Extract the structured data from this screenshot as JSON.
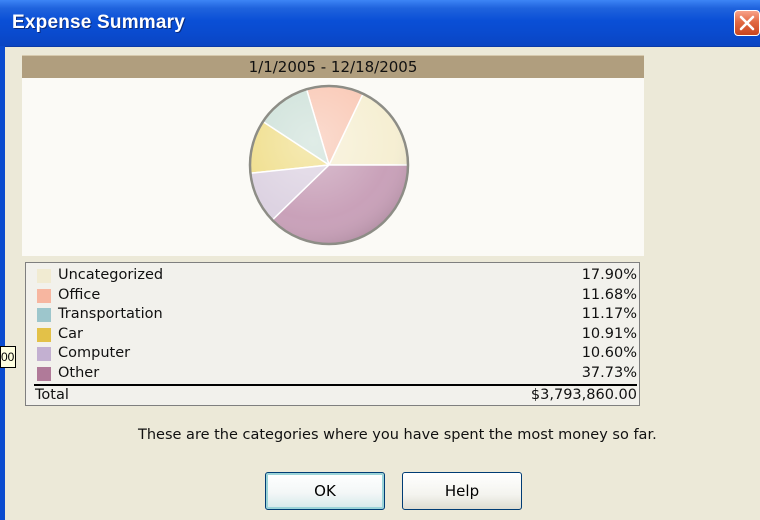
{
  "window": {
    "title": "Expense Summary",
    "close_icon": "close-icon"
  },
  "summary": {
    "date_range": "1/1/2005 - 12/18/2005"
  },
  "chart_data": {
    "type": "pie",
    "slices": [
      {
        "label": "Uncategorized",
        "value": 17.9,
        "color": "#f6efd3"
      },
      {
        "label": "Office",
        "value": 11.68,
        "color": "#f9c9b6"
      },
      {
        "label": "Transportation",
        "value": 11.17,
        "color": "#cfe2da"
      },
      {
        "label": "Car",
        "value": 10.91,
        "color": "#f0df8e"
      },
      {
        "label": "Computer",
        "value": 10.6,
        "color": "#ddd3e2"
      },
      {
        "label": "Other",
        "value": 37.73,
        "color": "#c9a1b9"
      }
    ]
  },
  "legend": {
    "rows": [
      {
        "label": "Uncategorized",
        "percent": "17.90%",
        "color": "#f1ebd2"
      },
      {
        "label": "Office",
        "percent": "11.68%",
        "color": "#f7b6a0"
      },
      {
        "label": "Transportation",
        "percent": "11.17%",
        "color": "#9dc6cc"
      },
      {
        "label": "Car",
        "percent": "10.91%",
        "color": "#e3c148"
      },
      {
        "label": "Computer",
        "percent": "10.60%",
        "color": "#c3b0d1"
      },
      {
        "label": "Other",
        "percent": "37.73%",
        "color": "#b07a99"
      }
    ],
    "total_label": "Total",
    "total_value": "$3,793,860.00"
  },
  "tooltip": {
    "text": "00"
  },
  "message": "These are the categories where you have spent the most money so far.",
  "buttons": {
    "ok": "OK",
    "help": "Help"
  }
}
